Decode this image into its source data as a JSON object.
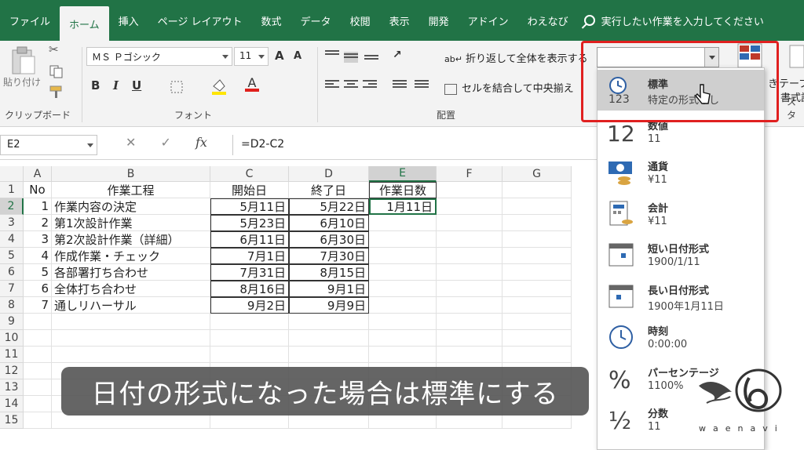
{
  "tabs": [
    "ファイル",
    "ホーム",
    "挿入",
    "ページ レイアウト",
    "数式",
    "データ",
    "校閲",
    "表示",
    "開発",
    "アドイン",
    "わえなび"
  ],
  "active_tab": "ホーム",
  "tell_me": "実行したい作業を入力してください",
  "ribbon": {
    "clipboard_label": "クリップボード",
    "paste_label": "貼り付け",
    "font_label": "フォント",
    "font_name": "ＭＳ Ｐゴシック",
    "font_size": "11",
    "bold": "B",
    "italic": "I",
    "underline": "U",
    "grow_font": "A",
    "shrink_font": "A",
    "alignment_label": "配置",
    "wrap_text": "折り返して全体を表示する",
    "merge_center": "セルを結合して中央揃え",
    "table_label": "テーブル",
    "cell_style_label": "書式設",
    "style_group_label": "スタ",
    "partial_label": "き"
  },
  "formula_bar": {
    "name_box": "E2",
    "formula": "=D2-C2",
    "fx": "fx"
  },
  "columns": [
    "A",
    "B",
    "C",
    "D",
    "E",
    "F",
    "G"
  ],
  "rows": [
    "1",
    "2",
    "3",
    "4",
    "5",
    "6",
    "7",
    "8",
    "9",
    "10",
    "11",
    "12",
    "13",
    "14",
    "15"
  ],
  "table": {
    "header": [
      "No",
      "作業工程",
      "開始日",
      "終了日",
      "作業日数"
    ],
    "data": [
      [
        "1",
        "作業内容の決定",
        "5月11日",
        "5月22日",
        "1月11日"
      ],
      [
        "2",
        "第1次設計作業",
        "5月23日",
        "6月10日",
        ""
      ],
      [
        "3",
        "第2次設計作業（詳細）",
        "6月11日",
        "6月30日",
        ""
      ],
      [
        "4",
        "作成作業・チェック",
        "7月1日",
        "7月30日",
        ""
      ],
      [
        "5",
        "各部署打ち合わせ",
        "7月31日",
        "8月15日",
        ""
      ],
      [
        "6",
        "全体打ち合わせ",
        "8月16日",
        "9月1日",
        ""
      ],
      [
        "7",
        "通しリハーサル",
        "9月2日",
        "9月9日",
        ""
      ]
    ]
  },
  "number_formats": [
    {
      "name": "標準",
      "sample": "特定の形式なし",
      "icon": "clock-123-icon"
    },
    {
      "name": "数値",
      "sample": "11",
      "icon": "number-12-icon"
    },
    {
      "name": "通貨",
      "sample": "¥11",
      "icon": "currency-icon"
    },
    {
      "name": "会計",
      "sample": "¥11",
      "icon": "accounting-icon"
    },
    {
      "name": "短い日付形式",
      "sample": "1900/1/11",
      "icon": "calendar-short-icon"
    },
    {
      "name": "長い日付形式",
      "sample": "1900年1月11日",
      "icon": "calendar-long-icon"
    },
    {
      "name": "時刻",
      "sample": "0:00:00",
      "icon": "clock-icon"
    },
    {
      "name": "パーセンテージ",
      "sample": "1100%",
      "icon": "percent-icon"
    },
    {
      "name": "分数",
      "sample": "11",
      "icon": "fraction-icon"
    }
  ],
  "caption": "日付の形式になった場合は標準にする",
  "logo_text": "waenavi",
  "colors": {
    "excel_green": "#217346",
    "highlight_red": "#e02020"
  }
}
